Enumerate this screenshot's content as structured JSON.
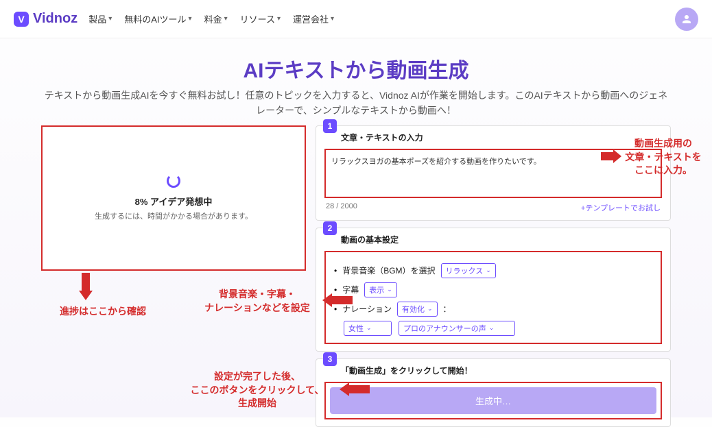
{
  "brand": "Vidnoz",
  "nav": {
    "product": "製品",
    "free_tools": "無料のAIツール",
    "pricing": "料金",
    "resources": "リソース",
    "company": "運営会社"
  },
  "hero": {
    "title": "AIテキストから動画生成",
    "subtitle": "テキストから動画生成AIを今すぐ無料お試し！任意のトピックを入力すると、Vidnoz AIが作業を開始します。このAIテキストから動画へのジェネレーターで、シンプルなテキストから動画へ！"
  },
  "preview": {
    "percent": "8%",
    "status": "アイデア発想中",
    "note": "生成するには、時間がかかる場合があります。"
  },
  "step1": {
    "num": "1",
    "title": "文章・テキストの入力",
    "value": "リラックスヨガの基本ポーズを紹介する動画を作りたいです。",
    "counter": "28 / 2000",
    "template_link": "+テンプレートでお試し"
  },
  "step2": {
    "num": "2",
    "title": "動画の基本設定",
    "bgm_label": "背景音楽（BGM）を選択",
    "bgm_value": "リラックス",
    "subtitle_label": "字幕",
    "subtitle_value": "表示",
    "narration_label": "ナレーション",
    "narration_value": "有効化",
    "colon": "：",
    "voice_gender": "女性",
    "voice_style": "プロのアナウンサーの声"
  },
  "step3": {
    "num": "3",
    "title": "「動画生成」をクリックして開始！",
    "button": "生成中…"
  },
  "annotations": {
    "right": "動画生成用の\n文章・テキストを\nここに入力。",
    "progress": "進捗はここから確認",
    "settings": "背景音楽・字幕・\nナレーションなどを設定",
    "generate": "設定が完了した後、\nここのボタンをクリックして、\n生成開始"
  }
}
